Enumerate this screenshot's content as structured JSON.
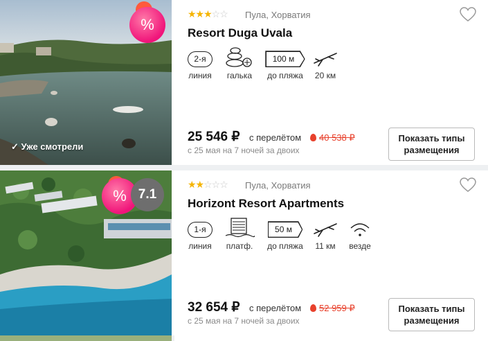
{
  "hotels": [
    {
      "stars_filled": 3,
      "stars_total": 5,
      "location": "Пула, Хорватия",
      "name": "Resort Duga Uvala",
      "discount_symbol": "%",
      "seen_label": "✓ Уже смотрели",
      "features": [
        {
          "icon": "line-icon",
          "value": "2-я",
          "label": "линия"
        },
        {
          "icon": "pebble-icon",
          "label": "галька"
        },
        {
          "icon": "distance-flag-icon",
          "value": "100 м",
          "label": "до пляжа"
        },
        {
          "icon": "plane-icon",
          "label": "20 км"
        }
      ],
      "price": "25 546 ₽",
      "with_flight": "с перелётом",
      "old_price": "40 538 ₽",
      "dates": "с 25 мая на 7 ночей за двоих",
      "button_label": "Показать типы\nразмещения"
    },
    {
      "stars_filled": 2,
      "stars_total": 5,
      "location": "Пула, Хорватия",
      "name": "Horizont Resort Apartments",
      "discount_symbol": "%",
      "rating": "7.1",
      "features": [
        {
          "icon": "line-icon",
          "value": "1-я",
          "label": "линия"
        },
        {
          "icon": "platform-icon",
          "label": "платф."
        },
        {
          "icon": "distance-flag-icon",
          "value": "50 м",
          "label": "до пляжа"
        },
        {
          "icon": "plane-icon",
          "label": "11 км"
        },
        {
          "icon": "wifi-icon",
          "label": "везде"
        }
      ],
      "price": "32 654 ₽",
      "with_flight": "с перелётом",
      "old_price": "52 959 ₽",
      "dates": "с 25 мая на 7 ночей за двоих",
      "button_label": "Показать типы\nразмещения"
    }
  ],
  "colors": {
    "star": "#f5b400",
    "discount_badge": "#f0147a",
    "old_price": "#e8412c",
    "rating_badge": "#6e6e6e"
  }
}
